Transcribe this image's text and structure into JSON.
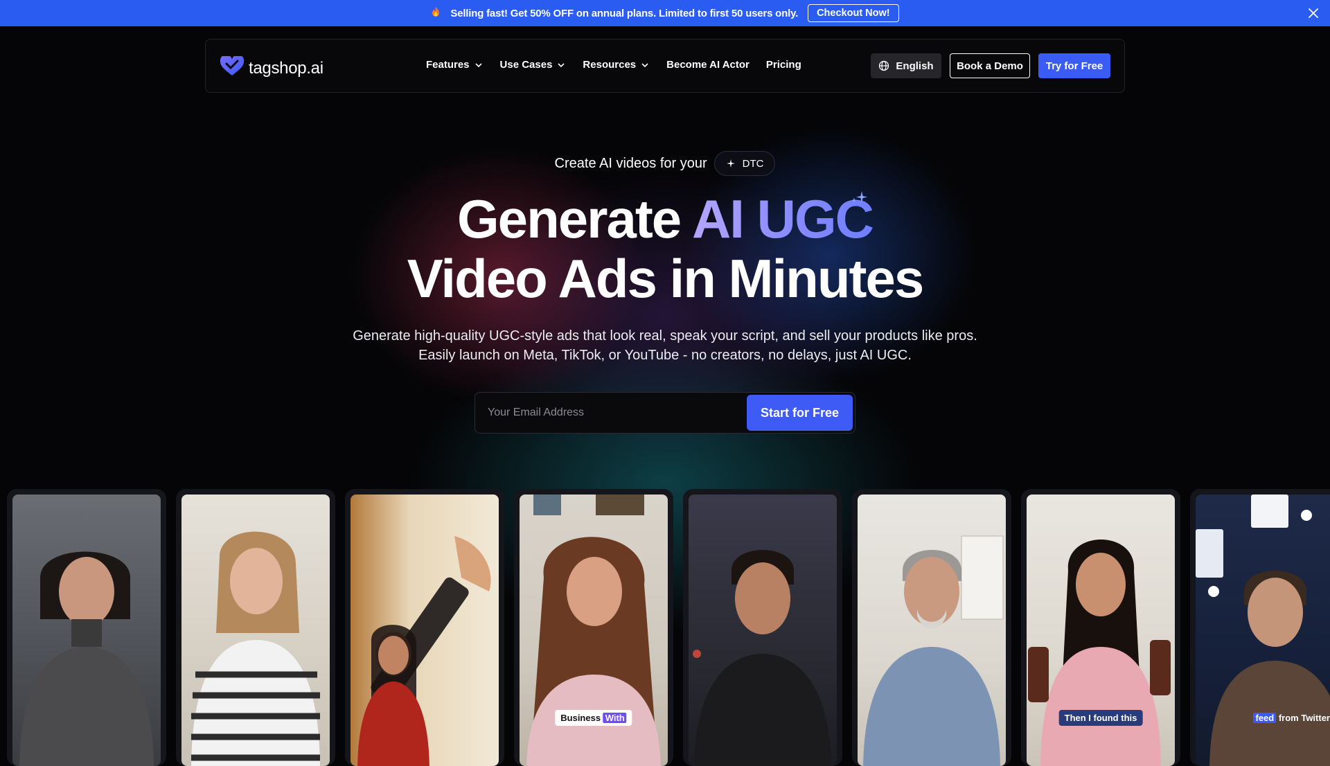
{
  "promo": {
    "text": "Selling fast! Get 50% OFF on annual plans. Limited to first 50 users only.",
    "cta": "Checkout Now!"
  },
  "nav": {
    "logo": "tagshop.ai",
    "menu": [
      "Features",
      "Use Cases",
      "Resources",
      "Become AI Actor",
      "Pricing"
    ],
    "language": "English",
    "book_demo": "Book a Demo",
    "try_free": "Try for Free"
  },
  "hero": {
    "kicker": "Create AI videos for your",
    "kicker_tag": "DTC",
    "title_part1": "Generate",
    "title_highlight": "AI UGC",
    "title_line2": "Video Ads in Minutes",
    "description_line1": "Generate high-quality UGC-style ads that look real, speak your script, and sell your products like pros.",
    "description_line2": "Easily launch on Meta, TikTok, or YouTube - no creators, no delays, just AI UGC.",
    "email_placeholder": "Your Email Address",
    "cta": "Start for Free"
  },
  "cards": [
    {
      "caption": ""
    },
    {
      "caption": ""
    },
    {
      "caption": ""
    },
    {
      "caption_a": "Business",
      "caption_b": "With"
    },
    {
      "caption": ""
    },
    {
      "caption": ""
    },
    {
      "caption": "Then I found this"
    },
    {
      "caption_a": "feed",
      "caption_b": "from Twitter"
    }
  ],
  "colors": {
    "promo_bg": "#2a5cf2",
    "accent": "#3b5bf5",
    "highlight_gradient_start": "#b3a6ff",
    "highlight_gradient_end": "#6f7eff"
  }
}
